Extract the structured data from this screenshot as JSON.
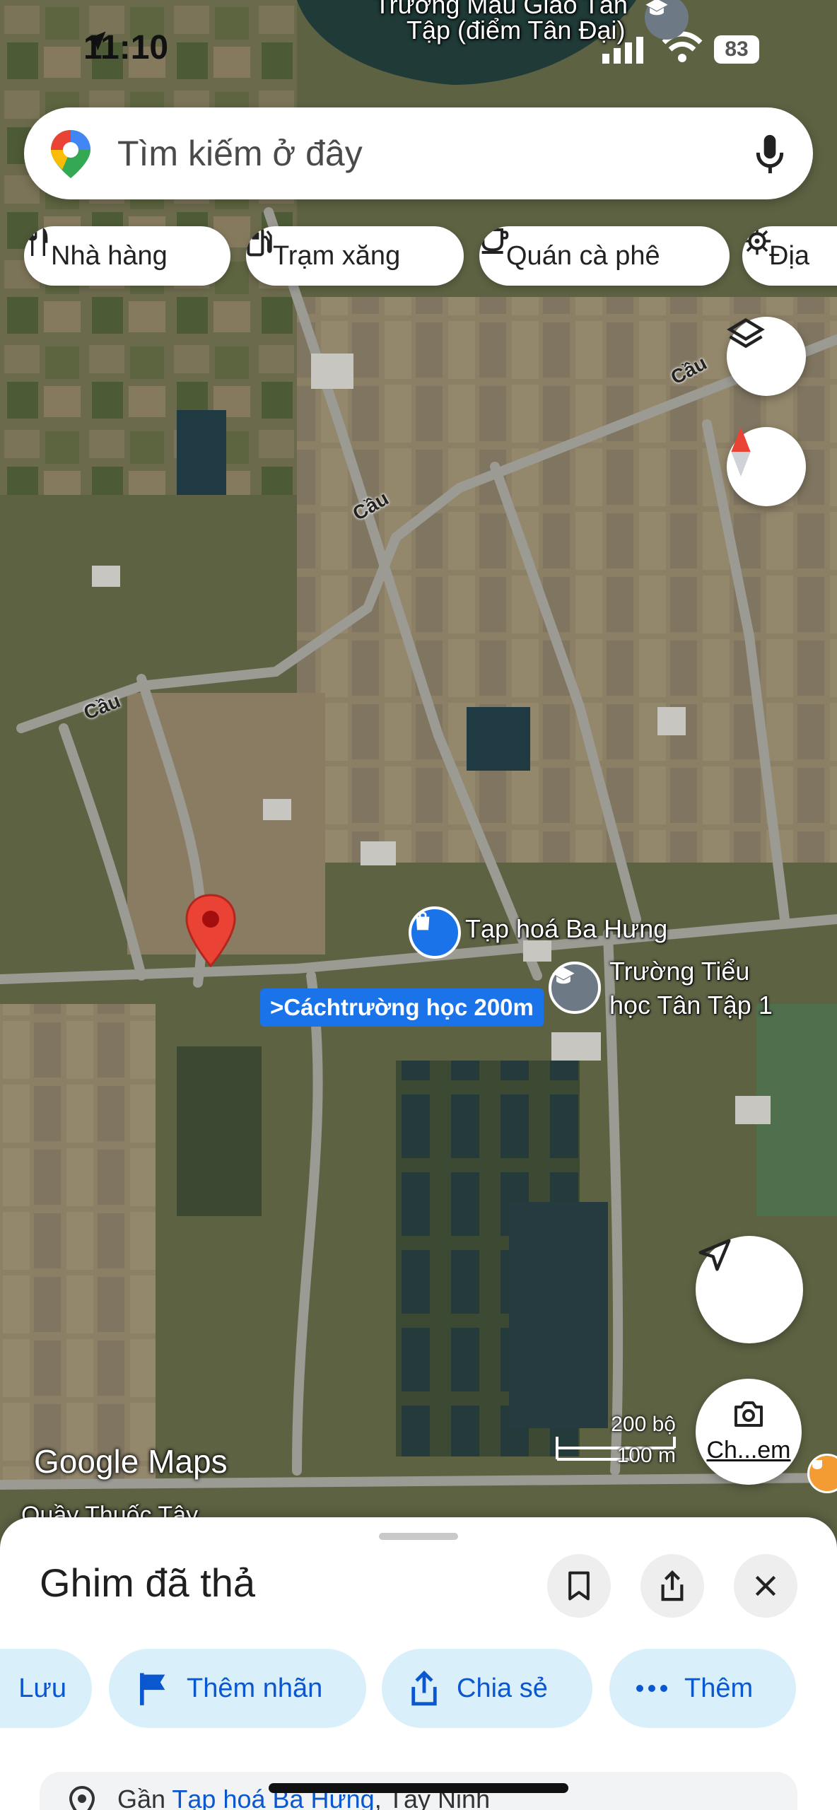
{
  "status_bar": {
    "time": "11:10",
    "battery": "83"
  },
  "search": {
    "placeholder": "Tìm kiếm ở đây"
  },
  "chips": [
    {
      "label": "Nhà hàng",
      "icon": "restaurant-icon"
    },
    {
      "label": "Trạm xăng",
      "icon": "gas-station-icon"
    },
    {
      "label": "Quán cà phê",
      "icon": "coffee-icon"
    },
    {
      "label": "Địa",
      "icon": "attraction-icon"
    }
  ],
  "map": {
    "top_place_line1": "Trường Mầu Giáo Tân",
    "top_place_line2": "Tập (điểm Tân Đại)",
    "road_labels": [
      "Cầu",
      "Cầu",
      "Cầu"
    ],
    "poi_shop": "Tạp hoá Ba Hưng",
    "poi_school_line1": "Trường Tiểu",
    "poi_school_line2": "học Tân Tập 1",
    "distance_label": ">Cáchtrường học 200m",
    "bottom_partial": "Quầy Thuốc Tây",
    "branding": "Google Maps",
    "scale_top": "200 bộ",
    "scale_bottom": "100 m",
    "camera_label": "Ch...em"
  },
  "sheet": {
    "title": "Ghim đã thả",
    "actions": [
      {
        "label": "Lưu",
        "icon": "bookmark-icon"
      },
      {
        "label": "Thêm nhãn",
        "icon": "flag-icon"
      },
      {
        "label": "Chia sẻ",
        "icon": "share-icon"
      },
      {
        "label": "Thêm",
        "icon": "more-icon"
      }
    ],
    "address_prefix": "Gần ",
    "address_link": "Tạp hoá Ba Hưng",
    "address_suffix": ", Tây Ninh"
  },
  "colors": {
    "pin_red": "#ea4335",
    "accent_blue": "#1a73e8",
    "chip_blue": "#d9f0fb",
    "link_blue": "#0b57d0"
  }
}
